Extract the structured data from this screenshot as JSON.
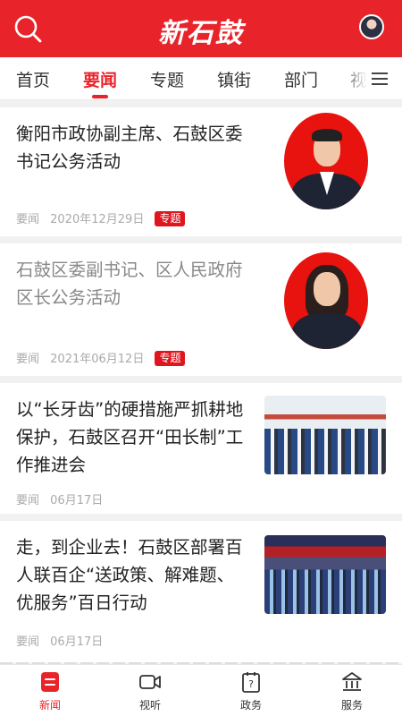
{
  "header": {
    "logo_text": "新石鼓",
    "colors": {
      "brand": "#e8242a"
    }
  },
  "tabs": [
    {
      "label": "首页",
      "active": false
    },
    {
      "label": "要闻",
      "active": true
    },
    {
      "label": "专题",
      "active": false
    },
    {
      "label": "镇街",
      "active": false
    },
    {
      "label": "部门",
      "active": false
    },
    {
      "label": "视",
      "active": false
    }
  ],
  "articles": [
    {
      "title": "衡阳市政协副主席、石鼓区委书记公务活动",
      "category": "要闻",
      "date": "2020年12月29日",
      "badge": "专题"
    },
    {
      "title": "石鼓区委副书记、区人民政府区长公务活动",
      "category": "要闻",
      "date": "2021年06月12日",
      "badge": "专题"
    },
    {
      "title": "以“长牙齿”的硬措施严抓耕地保护，石鼓区召开“田长制”工作推进会",
      "category": "要闻",
      "date": "06月17日"
    },
    {
      "title": "走，到企业去！石鼓区部署百人联百企“送政策、解难题、优服务”百日行动",
      "category": "要闻",
      "date": "06月17日"
    }
  ],
  "bottom_nav": [
    {
      "label": "新闻",
      "icon": "news-icon",
      "active": true
    },
    {
      "label": "视听",
      "icon": "video-icon",
      "active": false
    },
    {
      "label": "政务",
      "icon": "government-affairs-icon",
      "active": false
    },
    {
      "label": "服务",
      "icon": "services-icon",
      "active": false
    }
  ]
}
